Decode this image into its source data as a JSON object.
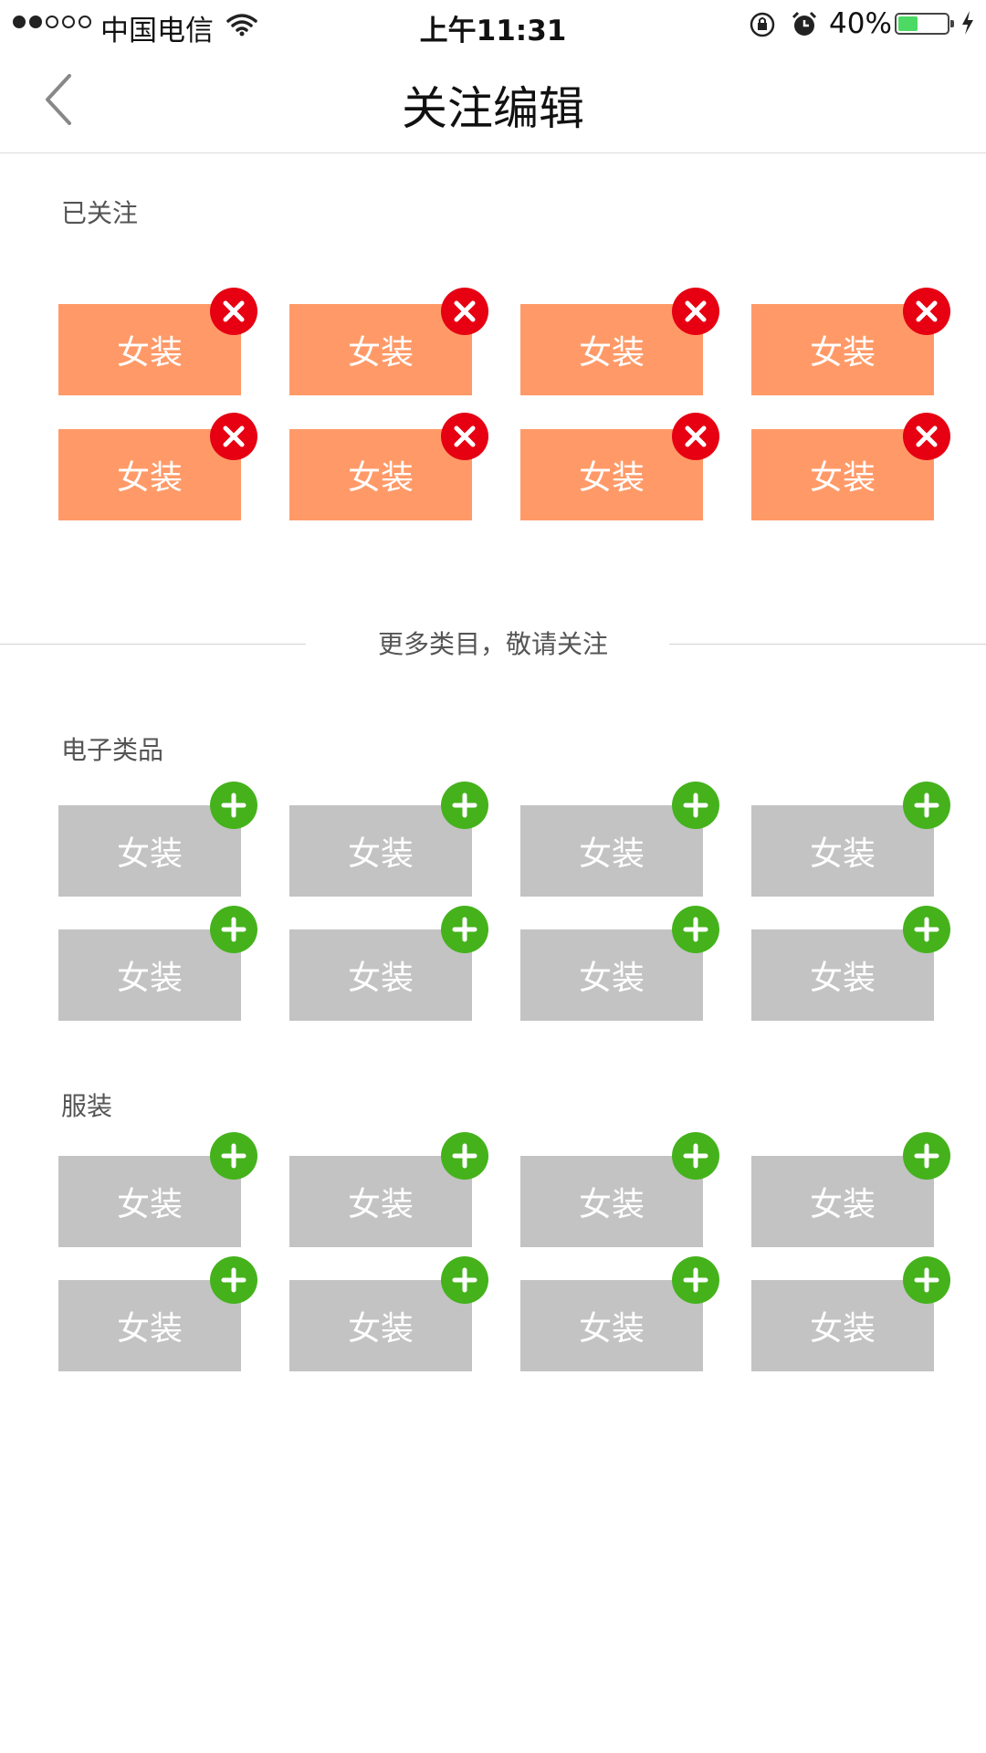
{
  "status_bar": {
    "carrier": "中国电信",
    "time": "上午11:31",
    "battery_percent": "40%",
    "battery_level": 0.4,
    "signal_bars_filled": 2,
    "signal_bars_total": 5
  },
  "nav": {
    "title": "关注编辑"
  },
  "followed": {
    "label": "已关注",
    "tags": [
      "女装",
      "女装",
      "女装",
      "女装",
      "女装",
      "女装",
      "女装",
      "女装"
    ]
  },
  "divider": {
    "text": "更多类目，敬请关注"
  },
  "categories": [
    {
      "label": "电子类品",
      "tags": [
        "女装",
        "女装",
        "女装",
        "女装",
        "女装",
        "女装",
        "女装",
        "女装"
      ]
    },
    {
      "label": "服装",
      "tags": [
        "女装",
        "女装",
        "女装",
        "女装",
        "女装",
        "女装",
        "女装",
        "女装"
      ]
    }
  ],
  "colors": {
    "followed_tag": "#ff9a68",
    "available_tag": "#c3c3c3",
    "remove_badge": "#e60012",
    "add_badge": "#45b21c"
  },
  "icons": {
    "remove": "close-icon",
    "add": "plus-icon",
    "back": "chevron-left-icon"
  }
}
